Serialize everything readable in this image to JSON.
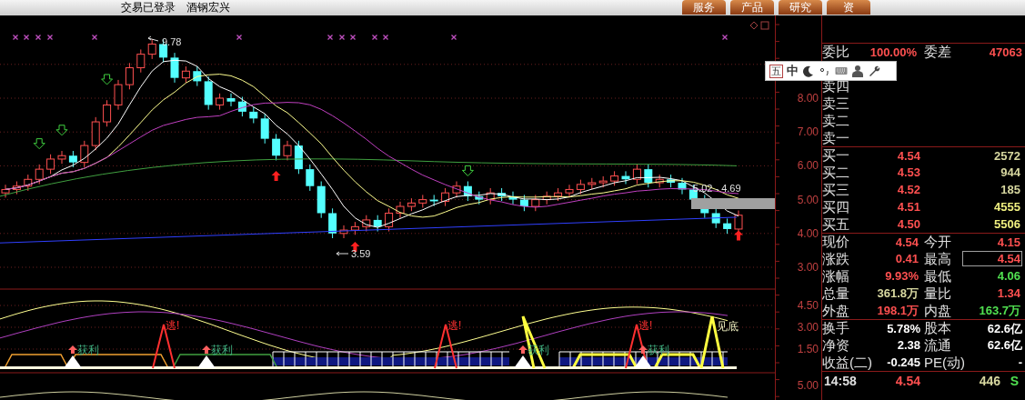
{
  "title_bar": {
    "status": "交易已登录",
    "stock_name": "酒钢宏兴",
    "tabs": [
      {
        "label": "服务"
      },
      {
        "label": "产品"
      },
      {
        "label": "研究"
      },
      {
        "label": "资"
      }
    ]
  },
  "price_chart": {
    "y_ticks": [
      "8.00",
      "7.00",
      "6.00",
      "5.00",
      "4.00",
      "3.00"
    ],
    "annotations": [
      {
        "kind": "high",
        "text": "9.78"
      },
      {
        "kind": "low",
        "text": "3.59"
      },
      {
        "kind": "range",
        "text": "5.02 - 4.69"
      }
    ]
  },
  "indicator_chart": {
    "y_ticks": [
      "4.50",
      "3.00",
      "1.50"
    ],
    "signals": [
      {
        "kind": "profit",
        "text": "获利"
      },
      {
        "kind": "escape",
        "text": "逃!"
      },
      {
        "kind": "profit",
        "text": "获利"
      },
      {
        "kind": "escape",
        "text": "逃!"
      },
      {
        "kind": "profit",
        "text": "获利"
      },
      {
        "kind": "escape",
        "text": "逃!"
      },
      {
        "kind": "profit",
        "text": "获利"
      },
      {
        "kind": "bottom",
        "text": "见底"
      }
    ]
  },
  "lower_chart": {
    "y_ticks": [
      "5.00"
    ]
  },
  "ime_toolbar": {
    "mode": "五",
    "language": "中"
  },
  "quote_panel": {
    "order_ratio": {
      "label": "委比",
      "value": "100.00%",
      "label2": "委差",
      "value2": "47063"
    },
    "asks": [
      {
        "label": "卖四"
      },
      {
        "label": "卖三"
      },
      {
        "label": "卖二"
      },
      {
        "label": "卖一"
      }
    ],
    "bids": [
      {
        "label": "买一",
        "price": "4.54",
        "volume": "2572",
        "color": "#d8d8a0"
      },
      {
        "label": "买二",
        "price": "4.53",
        "volume": "944",
        "color": "#d8d8a0"
      },
      {
        "label": "买三",
        "price": "4.52",
        "volume": "185",
        "color": "#d8d8a0"
      },
      {
        "label": "买四",
        "price": "4.51",
        "volume": "4555",
        "color": "#f0f080"
      },
      {
        "label": "买五",
        "price": "4.50",
        "volume": "5506",
        "color": "#f0f080"
      }
    ],
    "stats": [
      {
        "label": "现价",
        "value": "4.54",
        "color": "#ff5050",
        "highlighted": false
      },
      {
        "label": "今开",
        "value": "4.15",
        "color": "#ff5050",
        "highlighted": false
      },
      {
        "label": "涨跌",
        "value": "0.41",
        "color": "#ff5050",
        "highlighted": false
      },
      {
        "label": "最高",
        "value": "4.54",
        "color": "#ff5050",
        "highlighted": true
      },
      {
        "label": "涨幅",
        "value": "9.93%",
        "color": "#ff5050",
        "highlighted": false
      },
      {
        "label": "最低",
        "value": "4.06",
        "color": "#50e050",
        "highlighted": false
      },
      {
        "label": "总量",
        "value": "361.8万",
        "color": "#d8d8a0",
        "highlighted": false
      },
      {
        "label": "量比",
        "value": "1.34",
        "color": "#ff5050",
        "highlighted": false
      },
      {
        "label": "外盘",
        "value": "198.1万",
        "color": "#ff5050",
        "highlighted": false
      },
      {
        "label": "内盘",
        "value": "163.7万",
        "color": "#50e050",
        "highlighted": false
      }
    ],
    "fundamentals": [
      {
        "label": "换手",
        "value": "5.78%"
      },
      {
        "label": "股本",
        "value": "62.6亿"
      },
      {
        "label": "净资",
        "value": "2.38"
      },
      {
        "label": "流通",
        "value": "62.6亿"
      },
      {
        "label": "收益(二)",
        "value": "-0.245"
      },
      {
        "label": "PE(动)",
        "value": "-"
      }
    ],
    "last_trade": {
      "time": "14:58",
      "price": "4.54",
      "volume": "446",
      "side": "S"
    }
  }
}
